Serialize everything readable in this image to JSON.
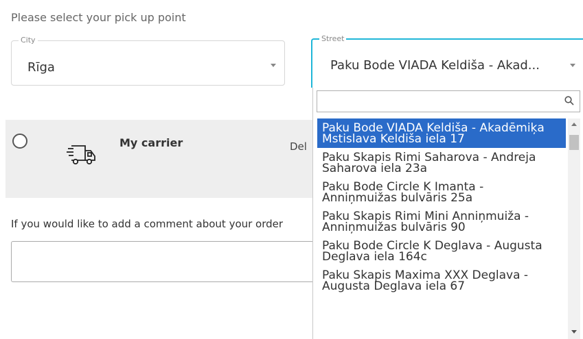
{
  "heading": "Please select your pick up point",
  "city": {
    "label": "City",
    "value": "Rīga"
  },
  "street": {
    "label": "Street",
    "value": "Paku Bode VIADA Keldiša - Akad..."
  },
  "carrier": {
    "name": "My carrier",
    "description": "Del"
  },
  "comment": {
    "label": "If you would like to add a comment about your order",
    "value": ""
  },
  "dropdown": {
    "search_value": "",
    "options": [
      "Paku Bode VIADA Keldiša - Akadēmiķa Mstislava Keldiša iela 17",
      "Paku Skapis Rimi Saharova - Andreja Saharova iela 23a",
      "Paku Bode Circle K Imanta - Anniņmuižas bulvāris 25a",
      "Paku Skapis Rimi Mini Anniņmuiža - Anniņmuižas bulvāris 90",
      "Paku Bode Circle K Deglava - Augusta Deglava iela 164c",
      "Paku Skapis Maxima XXX Deglava - Augusta Deglava iela 67"
    ],
    "selected_index": 0
  },
  "colors": {
    "accent_border": "#1fb6d8",
    "selected_bg": "#2a6bc9",
    "carrier_bg": "#eeeeee"
  }
}
